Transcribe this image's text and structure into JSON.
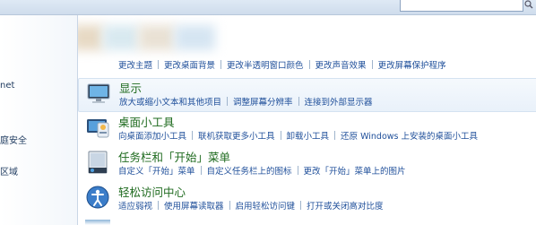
{
  "sidebar": {
    "items": [
      {
        "label": "net"
      },
      {
        "label": "庭安全"
      },
      {
        "label": "区域"
      }
    ]
  },
  "partial_top_links": [
    "更改主题",
    "更改桌面背景",
    "更改半透明窗口颜色",
    "更改声音效果",
    "更改屏幕保护程序"
  ],
  "categories": [
    {
      "title": "显示",
      "icon": "monitor-icon",
      "links": [
        "放大或缩小文本和其他项目",
        "调整屏幕分辨率",
        "连接到外部显示器"
      ]
    },
    {
      "title": "桌面小工具",
      "icon": "gadgets-icon",
      "links": [
        "向桌面添加小工具",
        "联机获取更多小工具",
        "卸载小工具",
        "还原 Windows 上安装的桌面小工具"
      ]
    },
    {
      "title": "任务栏和「开始」菜单",
      "icon": "taskbar-icon",
      "links": [
        "自定义「开始」菜单",
        "自定义任务栏上的图标",
        "更改「开始」菜单上的图片"
      ]
    },
    {
      "title": "轻松访问中心",
      "icon": "ease-of-access-icon",
      "links": [
        "适应弱视",
        "使用屏幕读取器",
        "启用轻松访问键",
        "打开或关闭高对比度"
      ]
    }
  ],
  "colors": {
    "category_title": "#1f6b1f",
    "link": "#1f4f9a"
  }
}
